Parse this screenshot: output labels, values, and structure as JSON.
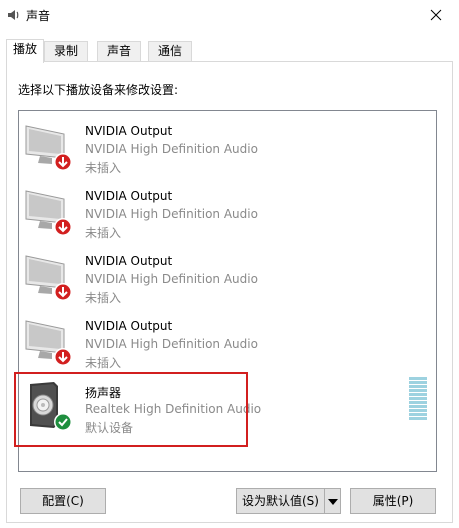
{
  "window": {
    "title": "声音",
    "close_icon": "close-icon"
  },
  "tabs": [
    {
      "label": "播放",
      "active": true
    },
    {
      "label": "录制",
      "active": false
    },
    {
      "label": "声音",
      "active": false
    },
    {
      "label": "通信",
      "active": false
    }
  ],
  "instruction": "选择以下播放设备来修改设置:",
  "devices": [
    {
      "name": "NVIDIA Output",
      "description": "NVIDIA High Definition Audio",
      "status": "未插入",
      "icon": "monitor-icon",
      "badge": "unplugged-badge"
    },
    {
      "name": "NVIDIA Output",
      "description": "NVIDIA High Definition Audio",
      "status": "未插入",
      "icon": "monitor-icon",
      "badge": "unplugged-badge"
    },
    {
      "name": "NVIDIA Output",
      "description": "NVIDIA High Definition Audio",
      "status": "未插入",
      "icon": "monitor-icon",
      "badge": "unplugged-badge"
    },
    {
      "name": "NVIDIA Output",
      "description": "NVIDIA High Definition Audio",
      "status": "未插入",
      "icon": "monitor-icon",
      "badge": "unplugged-badge"
    },
    {
      "name": "扬声器",
      "description": "Realtek High Definition Audio",
      "status": "默认设备",
      "icon": "speaker-icon",
      "badge": "default-check-badge"
    }
  ],
  "buttons": {
    "configure": "配置(C)",
    "set_default": "设为默认值(S)",
    "properties": "属性(P)"
  },
  "colors": {
    "unplugged_badge": "#d21f1f",
    "default_badge": "#1e8e3e",
    "highlight_border": "#d21f1f",
    "meter": "#9dd2e0"
  }
}
